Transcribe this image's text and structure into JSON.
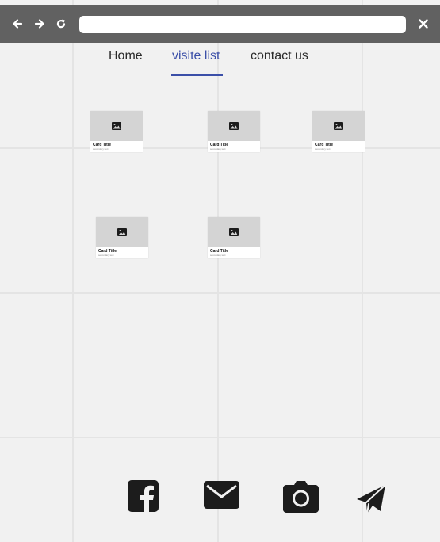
{
  "toolbar": {
    "back_icon": "arrow-left-icon",
    "forward_icon": "arrow-right-icon",
    "reload_icon": "reload-icon",
    "close_icon": "close-icon",
    "address_value": ""
  },
  "nav": {
    "items": [
      {
        "label": "Home",
        "active": false
      },
      {
        "label": "visite list",
        "active": true
      },
      {
        "label": "contact us",
        "active": false
      }
    ],
    "active_color": "#3b4fa8"
  },
  "cards": [
    {
      "title": "Card Title",
      "subtitle": "secondary text",
      "image_icon": "image-icon"
    },
    {
      "title": "Card Title",
      "subtitle": "secondary text",
      "image_icon": "image-icon"
    },
    {
      "title": "Card Title",
      "subtitle": "secondary text",
      "image_icon": "image-icon"
    },
    {
      "title": "Card Title",
      "subtitle": "secondary text",
      "image_icon": "image-icon"
    },
    {
      "title": "Card Title",
      "subtitle": "secondary text",
      "image_icon": "image-icon"
    }
  ],
  "footer": {
    "icons": [
      "facebook-icon",
      "mail-icon",
      "camera-icon",
      "send-icon"
    ]
  },
  "colors": {
    "toolbar": "#616161",
    "background": "#f1f1f1",
    "card_image": "#d4d4d4",
    "icon": "#1c1c1c"
  }
}
